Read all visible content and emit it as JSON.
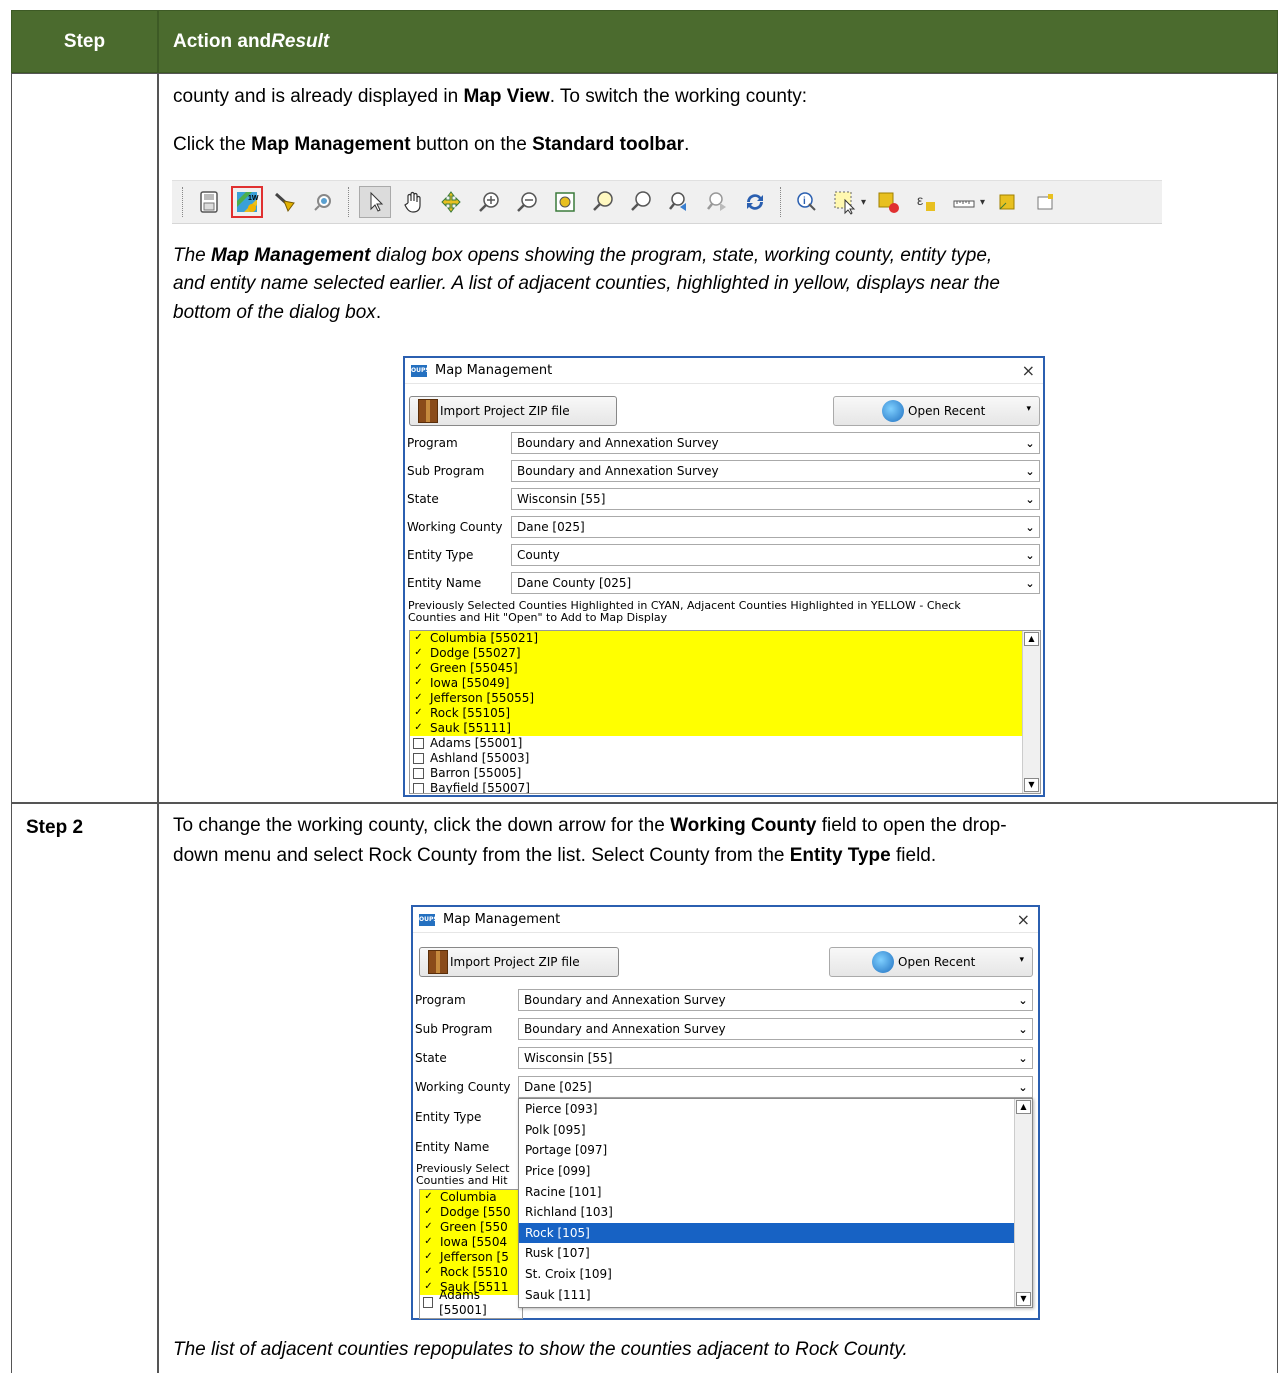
{
  "header": {
    "step": "Step",
    "action": "Action and ",
    "result": "Result"
  },
  "row1": {
    "line1_a": "county and is already displayed in ",
    "line1_b": "Map View",
    "line1_c": ". To switch the working county:",
    "line2_a": "Click the ",
    "line2_b": "Map Management",
    "line2_c": " button on the ",
    "line2_d": "Standard toolbar",
    "line2_e": ".",
    "result_a": "The ",
    "result_b": "Map Management",
    "result_c": " dialog box opens showing the program, state, working county, entity type,",
    "result_line2": "and entity name selected earlier. A list of adjacent counties, highlighted in yellow, displays near the",
    "result_line3": "bottom of the dialog box",
    "result_line3_end": "."
  },
  "row2": {
    "step": "Step 2",
    "line1_a": "To change the working county, click the down arrow for the ",
    "line1_b": "Working County",
    "line1_c": " field to open the drop-",
    "line2_a": "down menu and select Rock County from the list. Select County from the ",
    "line2_b": "Entity Type",
    "line2_c": " field.",
    "result": "The list of adjacent counties repopulates to show the counties adjacent to Rock County."
  },
  "toolbar": {
    "icons": [
      "save-icon",
      "map-management-icon",
      "edit-brush-icon",
      "pan-to-icon",
      "select-arrow-icon",
      "pan-hand-icon",
      "pan-to-selection-icon",
      "zoom-in-icon",
      "zoom-out-icon",
      "zoom-full-icon",
      "zoom-to-selection-icon",
      "zoom-to-layer-icon",
      "zoom-last-icon",
      "zoom-next-icon",
      "refresh-icon",
      "identify-icon",
      "select-features-icon",
      "deselect-icon",
      "expression-select-icon",
      "measure-icon",
      "new-layer-icon",
      "new-shapefile-icon"
    ]
  },
  "dialog": {
    "title": "Map Management",
    "close": "×",
    "import_label": "Import Project ZIP file",
    "recent_label": "Open Recent",
    "fields": {
      "program_label": "Program",
      "program_value": "Boundary and Annexation Survey",
      "subprogram_label": "Sub Program",
      "subprogram_value": "Boundary and Annexation Survey",
      "state_label": "State",
      "state_value": "Wisconsin [55]",
      "county_label": "Working County",
      "county_value": "Dane [025]",
      "etype_label": "Entity Type",
      "etype_value": "County",
      "ename_label": "Entity Name",
      "ename_value": "Dane County [025]"
    },
    "note_line1": "Previously Selected Counties Highlighted in CYAN, Adjacent Counties Highlighted in YELLOW - Check",
    "note_line2": "Counties and Hit \"Open\" to Add to Map Display",
    "note2_line1": "Previously Select",
    "note2_line2": "Counties and Hit",
    "counties_checked": [
      "Columbia [55021]",
      "Dodge [55027]",
      "Green [55045]",
      "Iowa [55049]",
      "Jefferson [55055]",
      "Rock [55105]",
      "Sauk [55111]"
    ],
    "counties_unchecked": [
      "Adams [55001]",
      "Ashland [55003]",
      "Barron [55005]",
      "Bayfield [55007]"
    ],
    "counties2_checked": [
      "Columbia",
      "Dodge [550",
      "Green [550",
      "Iowa [5504",
      "Jefferson [5",
      "Rock [5510",
      "Sauk [5511"
    ],
    "counties2_unchecked": [
      "Adams [55001]"
    ],
    "dropdown_items": [
      "Pierce [093]",
      "Polk [095]",
      "Portage [097]",
      "Price [099]",
      "Racine [101]",
      "Richland [103]",
      "Rock [105]",
      "Rusk [107]",
      "St. Croix [109]",
      "Sauk [111]"
    ],
    "dropdown_selected": "Rock [105]"
  },
  "colors": {
    "header_bg": "#4b6b2e",
    "highlight_yellow": "#ffff00",
    "selection_blue": "#1762c4",
    "toolbar_highlight": "#e03030"
  }
}
